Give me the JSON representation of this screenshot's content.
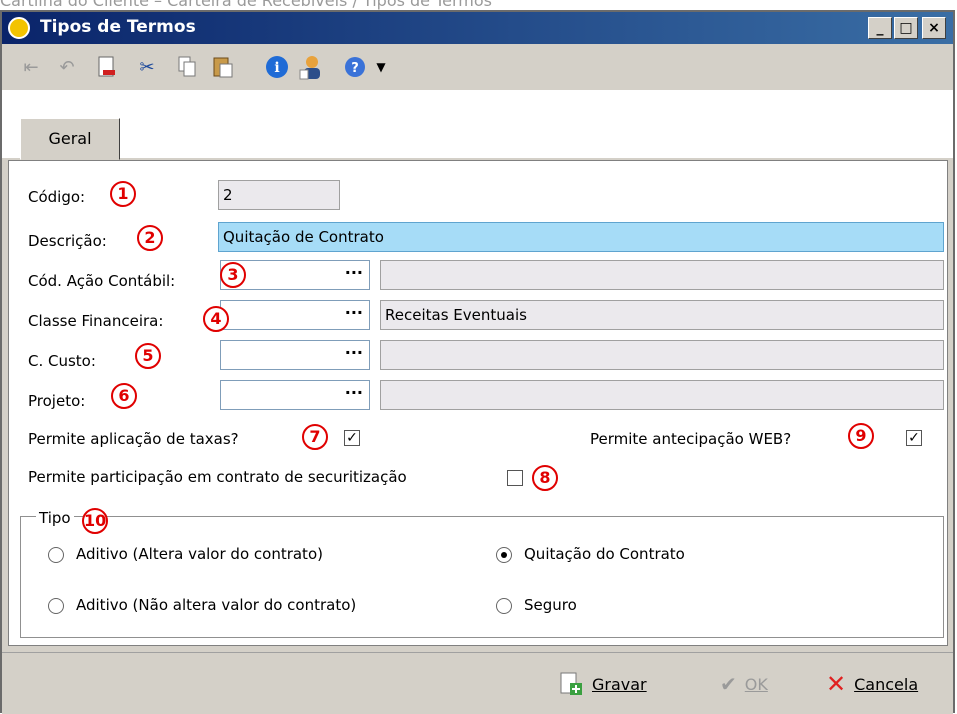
{
  "caption": "Cartilha do Cliente – Carteira de Recebíveis / Tipos de Termos",
  "window": {
    "title": "Tipos de Termos",
    "controls": {
      "minimize": "_",
      "maximize": "□",
      "close": "×"
    }
  },
  "tabs": [
    {
      "label": "Geral"
    }
  ],
  "form": {
    "codigo": {
      "label": "Código:",
      "value": "2",
      "badge": "1"
    },
    "descricao": {
      "label": "Descrição:",
      "value": "Quitação de Contrato",
      "badge": "2"
    },
    "acao": {
      "label": "Cód. Ação Contábil:",
      "value": "",
      "desc": "",
      "badge": "3"
    },
    "classe": {
      "label": "Classe Financeira:",
      "value": "",
      "desc": "Receitas Eventuais",
      "badge": "4"
    },
    "custo": {
      "label": "C. Custo:",
      "value": "",
      "desc": "",
      "badge": "5"
    },
    "projeto": {
      "label": "Projeto:",
      "value": "",
      "desc": "",
      "badge": "6"
    },
    "lookup_glyph": "···",
    "taxas": {
      "label": "Permite aplicação de taxas?",
      "checked": true,
      "badge": "7"
    },
    "securitizacao": {
      "label": "Permite participação em contrato de securitização",
      "checked": false,
      "badge": "8"
    },
    "web": {
      "label": "Permite antecipação WEB?",
      "checked": true,
      "badge": "9"
    },
    "check_mark": "✓"
  },
  "tipo": {
    "legend": "Tipo",
    "badge": "10",
    "options": [
      {
        "label": "Aditivo (Altera valor do contrato)",
        "selected": false
      },
      {
        "label": "Quitação do Contrato",
        "selected": true
      },
      {
        "label": "Aditivo (Não altera valor do contrato)",
        "selected": false
      },
      {
        "label": "Seguro",
        "selected": false
      }
    ]
  },
  "buttons": {
    "gravar": "Gravar",
    "ok": "OK",
    "cancela": "Cancela"
  },
  "colors": {
    "badge": "#e00000",
    "highlight": "#a6dcf7",
    "titlebar": "#0a246a"
  }
}
